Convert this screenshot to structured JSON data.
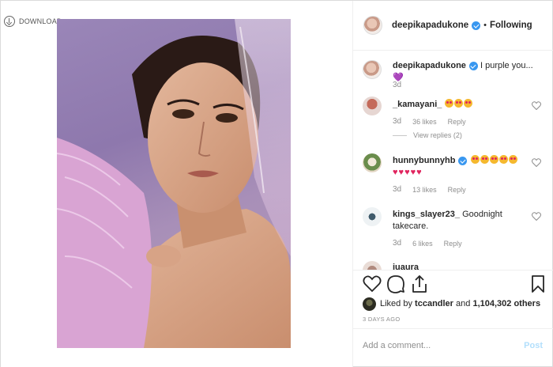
{
  "media": {
    "download_label": "DOWNLOAD"
  },
  "header": {
    "username": "deepikapadukone",
    "separator": "•",
    "follow_status": "Following"
  },
  "caption": {
    "username": "deepikapadukone",
    "text": "I purple you...",
    "emoji": "💜",
    "age": "3d"
  },
  "comments": [
    {
      "username": "_kamayani_",
      "age": "3d",
      "likes": "36 likes",
      "reply_label": "Reply",
      "view_replies": "View replies (2)"
    },
    {
      "username": "hunnybunnyhb",
      "age": "3d",
      "likes": "13 likes",
      "reply_label": "Reply"
    },
    {
      "username": "kings_slayer23_",
      "text": "Goodnight takecare.",
      "age": "3d",
      "likes": "6 likes",
      "reply_label": "Reply"
    },
    {
      "username": "juaura"
    }
  ],
  "likes": {
    "prefix": "Liked by",
    "user": "tccandler",
    "joiner": "and",
    "count": "1,104,302 others"
  },
  "time_ago": "3 DAYS AGO",
  "add_comment": {
    "placeholder": "Add a comment...",
    "post_label": "Post"
  },
  "icons": {
    "download": "download-icon",
    "verified": "verified-badge-icon",
    "like": "heart-icon",
    "comment": "comment-icon",
    "share": "share-icon",
    "save": "bookmark-icon"
  },
  "colors": {
    "verified_blue": "#3897f0",
    "post_button": "#b2dffc",
    "muted_text": "#8e8e8e",
    "emoji_heart": "#e0245e",
    "purple_heart": "#8a54c9"
  }
}
